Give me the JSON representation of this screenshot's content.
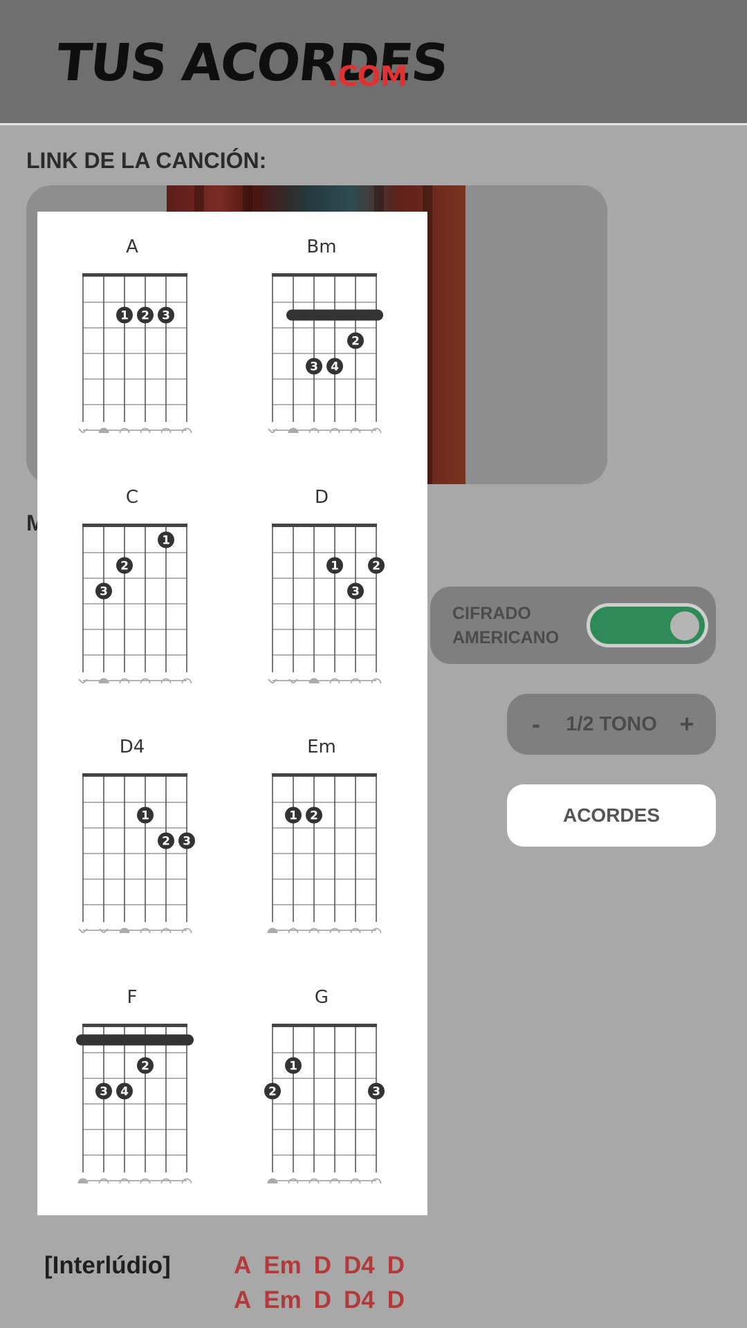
{
  "header": {
    "logo_main": "TUS ACORDES",
    "logo_suffix": ".COM"
  },
  "song_link_label": "LINK DE LA CANCIÓN:",
  "obscured_label_letter": "M",
  "notation_toggle": {
    "label": "CIFRADO AMERICANO",
    "enabled": true
  },
  "tone_control": {
    "minus": "-",
    "label": "1/2 TONO",
    "plus": "+"
  },
  "chords_button": {
    "label": "ACORDES"
  },
  "chord_diagrams": [
    {
      "name": "A",
      "barre": null,
      "fingers": [
        {
          "string": 3,
          "fret": 2,
          "n": "1"
        },
        {
          "string": 4,
          "fret": 2,
          "n": "2"
        },
        {
          "string": 5,
          "fret": 2,
          "n": "3"
        }
      ],
      "open": [
        "x",
        "root",
        "o",
        "o",
        "o",
        "o"
      ]
    },
    {
      "name": "Bm",
      "barre": {
        "fret": 2,
        "from": 2,
        "to": 6
      },
      "fingers": [
        {
          "string": 5,
          "fret": 3,
          "n": "2"
        },
        {
          "string": 3,
          "fret": 4,
          "n": "3"
        },
        {
          "string": 4,
          "fret": 4,
          "n": "4"
        }
      ],
      "open": [
        "x",
        "root",
        "o",
        "o",
        "o",
        "o"
      ]
    },
    {
      "name": "C",
      "barre": null,
      "fingers": [
        {
          "string": 5,
          "fret": 1,
          "n": "1"
        },
        {
          "string": 3,
          "fret": 2,
          "n": "2"
        },
        {
          "string": 2,
          "fret": 3,
          "n": "3"
        }
      ],
      "open": [
        "x",
        "root",
        "o",
        "o",
        "o",
        "o"
      ]
    },
    {
      "name": "D",
      "barre": null,
      "fingers": [
        {
          "string": 4,
          "fret": 2,
          "n": "1"
        },
        {
          "string": 6,
          "fret": 2,
          "n": "2"
        },
        {
          "string": 5,
          "fret": 3,
          "n": "3"
        }
      ],
      "open": [
        "x",
        "x",
        "root",
        "o",
        "o",
        "o"
      ]
    },
    {
      "name": "D4",
      "barre": null,
      "fingers": [
        {
          "string": 4,
          "fret": 2,
          "n": "1"
        },
        {
          "string": 5,
          "fret": 3,
          "n": "2"
        },
        {
          "string": 6,
          "fret": 3,
          "n": "3"
        }
      ],
      "open": [
        "x",
        "x",
        "root",
        "o",
        "o",
        "o"
      ]
    },
    {
      "name": "Em",
      "barre": null,
      "fingers": [
        {
          "string": 2,
          "fret": 2,
          "n": "1"
        },
        {
          "string": 3,
          "fret": 2,
          "n": "2"
        }
      ],
      "open": [
        "root",
        "o",
        "o",
        "o",
        "o",
        "o"
      ]
    },
    {
      "name": "F",
      "barre": {
        "fret": 1,
        "from": 1,
        "to": 6
      },
      "fingers": [
        {
          "string": 4,
          "fret": 2,
          "n": "2"
        },
        {
          "string": 2,
          "fret": 3,
          "n": "3"
        },
        {
          "string": 3,
          "fret": 3,
          "n": "4"
        }
      ],
      "open": [
        "root",
        "o",
        "o",
        "o",
        "o",
        "o"
      ]
    },
    {
      "name": "G",
      "barre": null,
      "fingers": [
        {
          "string": 2,
          "fret": 2,
          "n": "1"
        },
        {
          "string": 1,
          "fret": 3,
          "n": "2"
        },
        {
          "string": 6,
          "fret": 3,
          "n": "3"
        }
      ],
      "open": [
        "root",
        "o",
        "o",
        "o",
        "o",
        "o"
      ]
    }
  ],
  "song_section": {
    "label": "[Interlúdio]",
    "lines": [
      [
        "A",
        "Em",
        "D",
        "D4",
        "D"
      ],
      [
        "A",
        "Em",
        "D",
        "D4",
        "D"
      ]
    ]
  },
  "colors": {
    "accent_green": "#2e8b57",
    "logo_red": "#e03232",
    "chord_red": "#b23a3a"
  }
}
